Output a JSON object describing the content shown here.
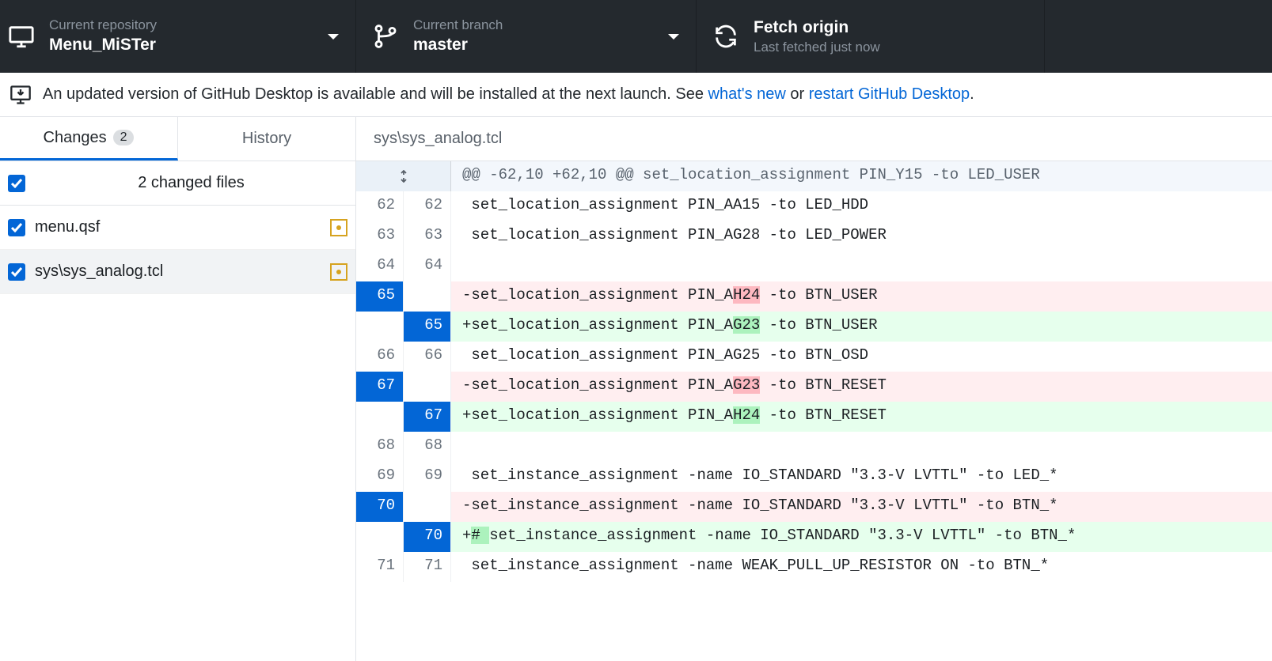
{
  "toolbar": {
    "repo_label": "Current repository",
    "repo_value": "Menu_MiSTer",
    "branch_label": "Current branch",
    "branch_value": "master",
    "fetch_label": "Fetch origin",
    "fetch_value": "Last fetched just now"
  },
  "banner": {
    "text_before": "An updated version of GitHub Desktop is available and will be installed at the next launch. See ",
    "link1": "what's new",
    "mid": " or ",
    "link2": "restart GitHub Desktop",
    "after": "."
  },
  "sidebar": {
    "tabs": {
      "changes": "Changes",
      "changes_count": "2",
      "history": "History"
    },
    "summary": "2 changed files",
    "files": [
      {
        "name": "menu.qsf"
      },
      {
        "name": "sys\\sys_analog.tcl"
      }
    ]
  },
  "diff": {
    "file": "sys\\sys_analog.tcl",
    "hunk": "@@ -62,10 +62,10 @@ set_location_assignment PIN_Y15 -to LED_USER",
    "lines": [
      {
        "t": "ctx",
        "o": "62",
        "n": "62",
        "c": " set_location_assignment PIN_AA15 -to LED_HDD"
      },
      {
        "t": "ctx",
        "o": "63",
        "n": "63",
        "c": " set_location_assignment PIN_AG28 -to LED_POWER"
      },
      {
        "t": "ctx",
        "o": "64",
        "n": "64",
        "c": " "
      },
      {
        "t": "del",
        "o": "65",
        "n": "",
        "c": "-set_location_assignment PIN_A",
        "hl": "H24",
        "c2": " -to BTN_USER"
      },
      {
        "t": "add",
        "o": "",
        "n": "65",
        "c": "+set_location_assignment PIN_A",
        "hl": "G23",
        "c2": " -to BTN_USER"
      },
      {
        "t": "ctx",
        "o": "66",
        "n": "66",
        "c": " set_location_assignment PIN_AG25 -to BTN_OSD"
      },
      {
        "t": "del",
        "o": "67",
        "n": "",
        "c": "-set_location_assignment PIN_A",
        "hl": "G23",
        "c2": " -to BTN_RESET"
      },
      {
        "t": "add",
        "o": "",
        "n": "67",
        "c": "+set_location_assignment PIN_A",
        "hl": "H24",
        "c2": " -to BTN_RESET"
      },
      {
        "t": "ctx",
        "o": "68",
        "n": "68",
        "c": " "
      },
      {
        "t": "ctx",
        "o": "69",
        "n": "69",
        "c": " set_instance_assignment -name IO_STANDARD \"3.3-V LVTTL\" -to LED_*"
      },
      {
        "t": "del",
        "o": "70",
        "n": "",
        "c": "-set_instance_assignment -name IO_STANDARD \"3.3-V LVTTL\" -to BTN_*"
      },
      {
        "t": "add",
        "o": "",
        "n": "70",
        "c": "+",
        "hl": "# ",
        "c2": "set_instance_assignment -name IO_STANDARD \"3.3-V LVTTL\" -to BTN_*"
      },
      {
        "t": "ctx",
        "o": "71",
        "n": "71",
        "c": " set_instance_assignment -name WEAK_PULL_UP_RESISTOR ON -to BTN_*"
      }
    ]
  }
}
